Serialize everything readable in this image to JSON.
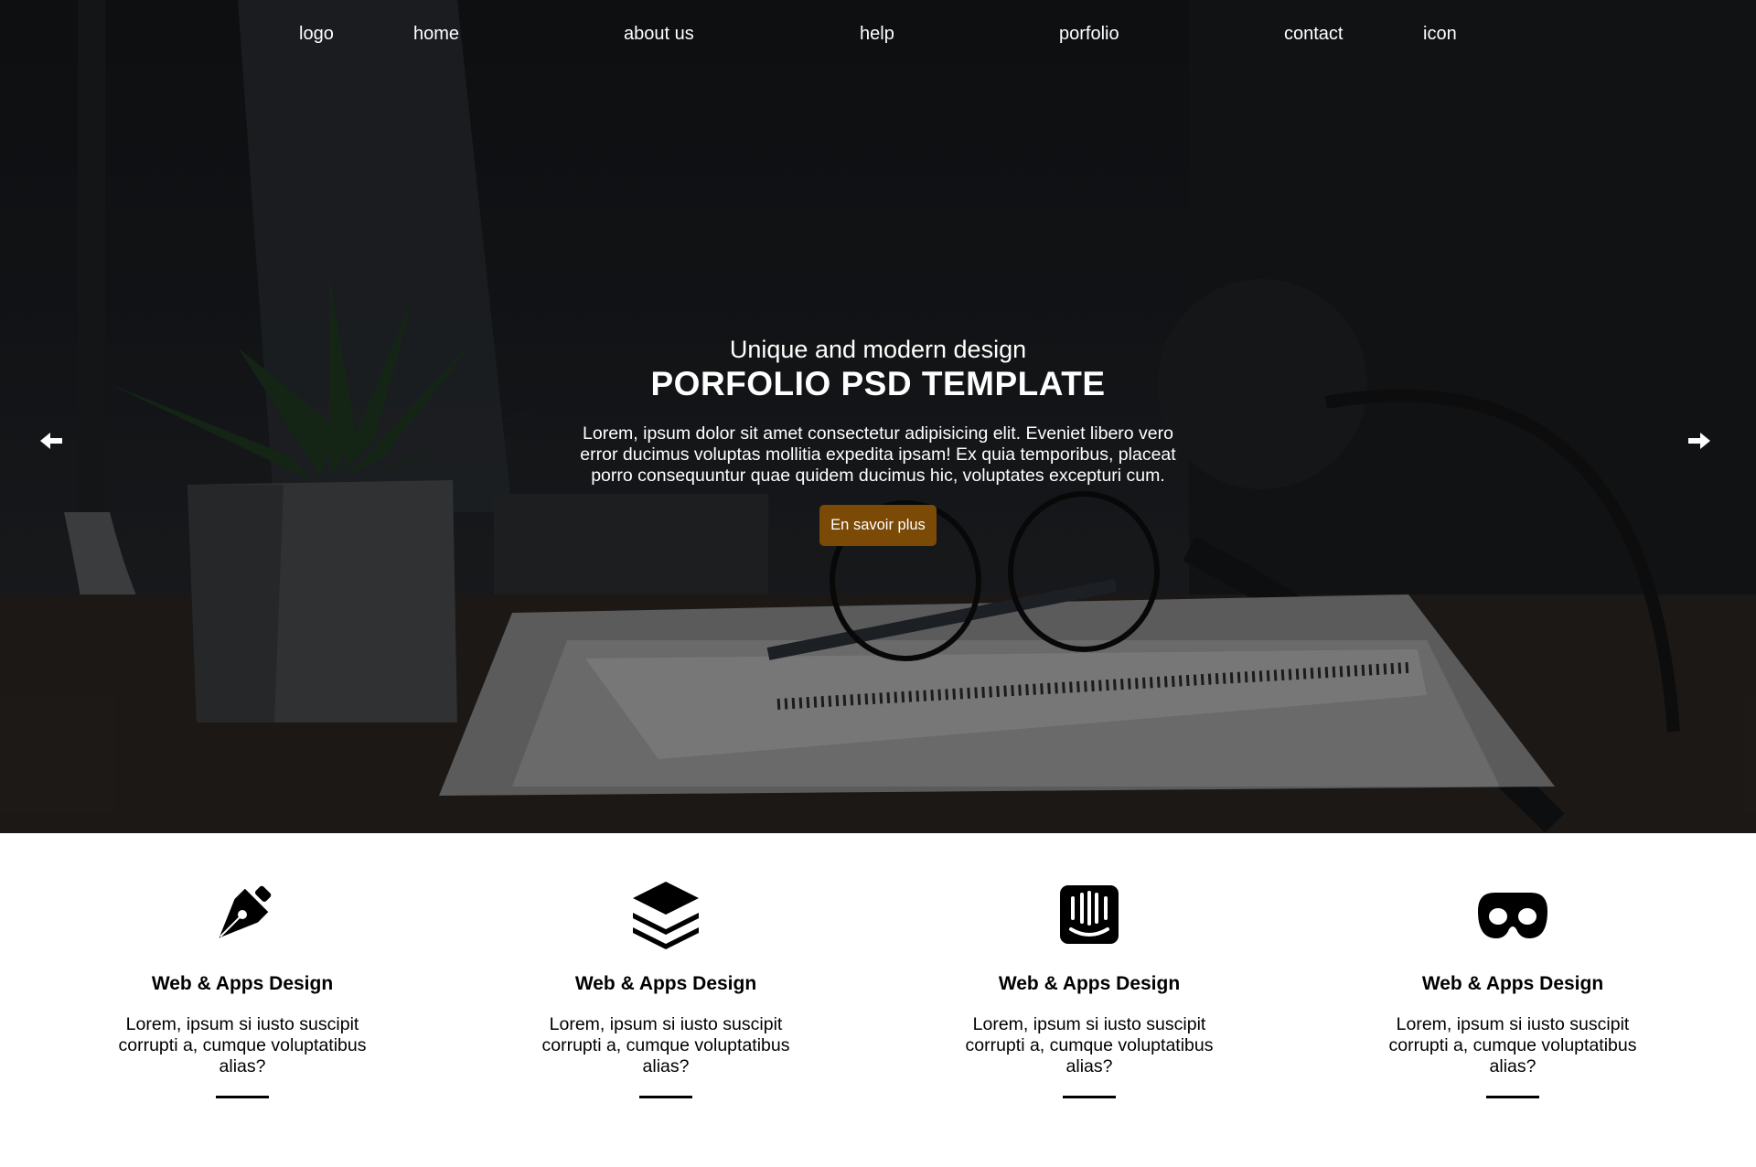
{
  "nav": {
    "items": [
      {
        "label": "logo"
      },
      {
        "label": "home"
      },
      {
        "label": "about us"
      },
      {
        "label": "help"
      },
      {
        "label": "porfolio"
      },
      {
        "label": "contact"
      },
      {
        "label": "icon"
      }
    ]
  },
  "hero": {
    "subtitle": "Unique and modern design",
    "title": "PORFOLIO PSD TEMPLATE",
    "description": "Lorem, ipsum dolor sit amet consectetur adipisicing elit. Eveniet libero vero error ducimus voluptas mollitia expedita ipsam! Ex quia temporibus, placeat porro consequuntur quae quidem ducimus hic, voluptates excepturi cum.",
    "cta_label": "En savoir plus",
    "cta_color": "#7b4a06",
    "prev_icon": "arrow-left-icon",
    "next_icon": "arrow-right-icon"
  },
  "features": [
    {
      "icon": "pen-nib-icon",
      "title": "Web & Apps Design",
      "text": "Lorem, ipsum si iusto suscipit corrupti a, cumque voluptatibus alias?"
    },
    {
      "icon": "layer-stack-icon",
      "title": "Web & Apps Design",
      "text": "Lorem, ipsum si iusto suscipit corrupti a, cumque voluptatibus alias?"
    },
    {
      "icon": "intercom-icon",
      "title": "Web & Apps Design",
      "text": "Lorem, ipsum si iusto suscipit corrupti a, cumque voluptatibus alias?"
    },
    {
      "icon": "mask-icon",
      "title": "Web & Apps Design",
      "text": "Lorem, ipsum si iusto suscipit corrupti a, cumque voluptatibus alias?"
    }
  ]
}
